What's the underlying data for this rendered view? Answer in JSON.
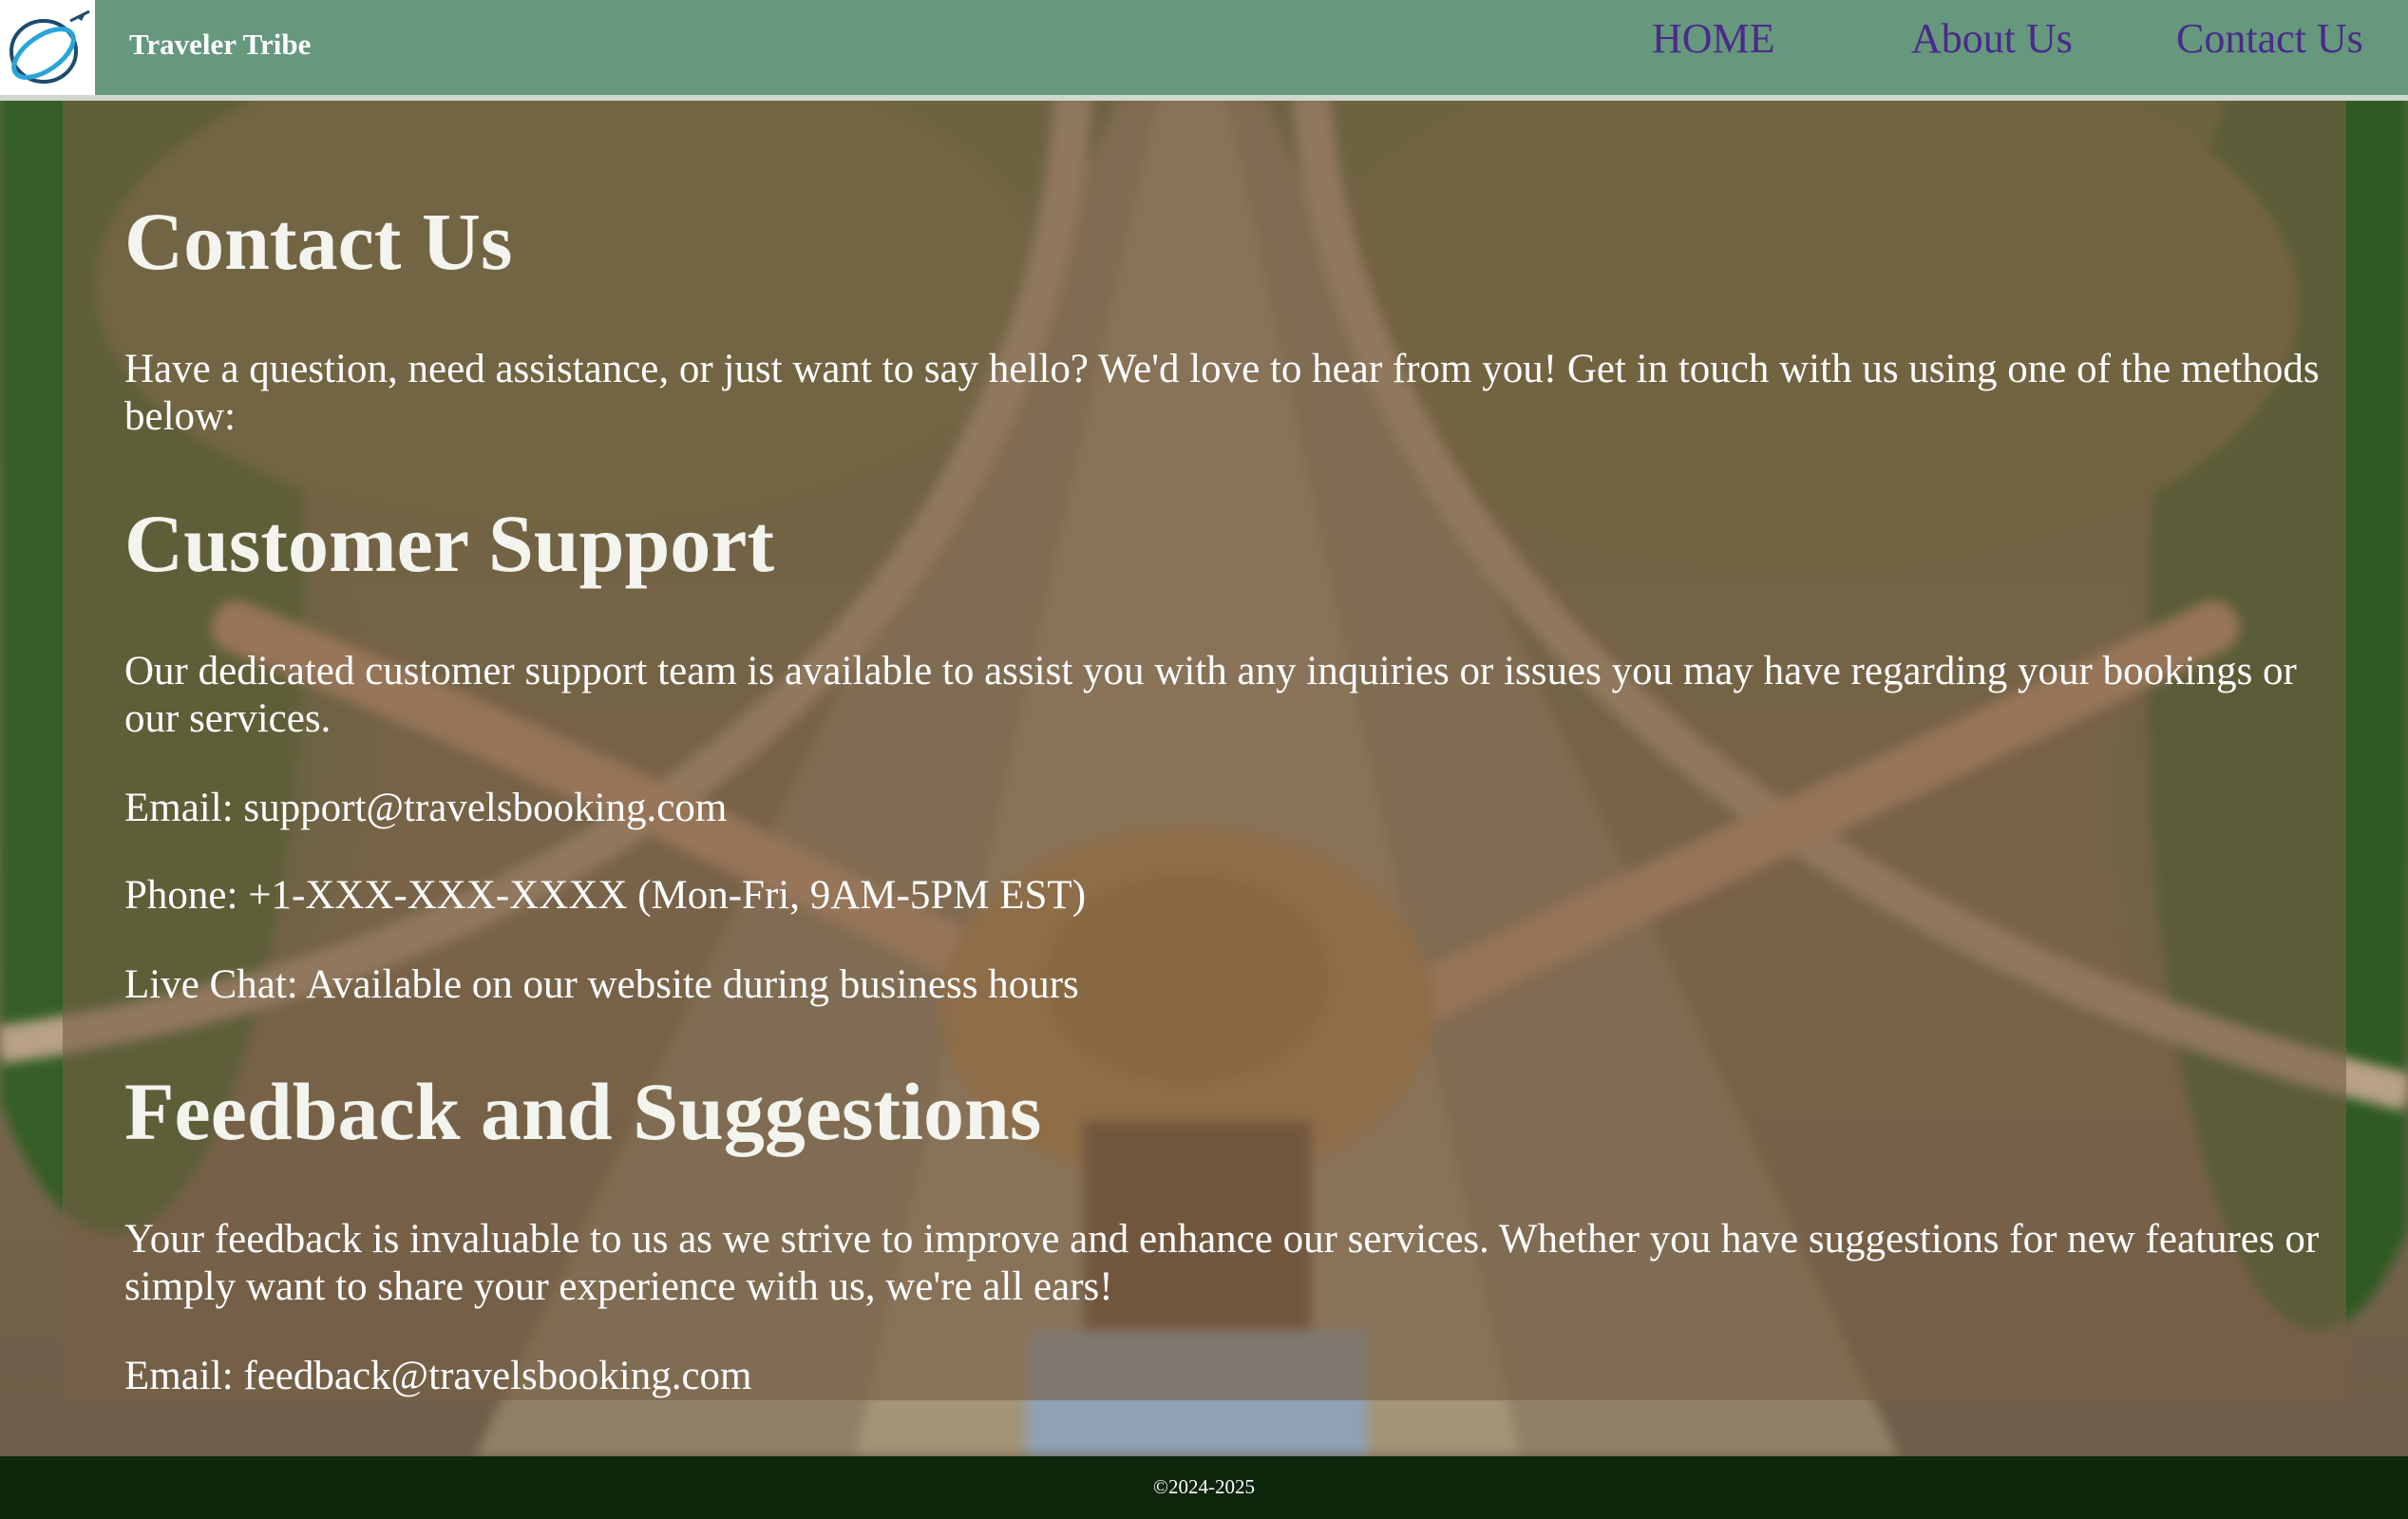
{
  "header": {
    "brand": "Traveler Tribe",
    "logo_icon": "globe-plane-logo",
    "nav": {
      "home": "HOME",
      "about": "About Us",
      "contact": "Contact Us"
    }
  },
  "main": {
    "title": "Contact Us",
    "intro": "Have a question, need assistance, or just want to say hello? We'd love to hear from you! Get in touch with us using one of the methods below:",
    "support": {
      "heading": "Customer Support",
      "description": "Our dedicated customer support team is available to assist you with any inquiries or issues you may have regarding your bookings or our services.",
      "email": "Email: support@travelsbooking.com",
      "phone": "Phone: +1-XXX-XXX-XXXX (Mon-Fri, 9AM-5PM EST)",
      "chat": "Live Chat: Available on our website during business hours"
    },
    "feedback": {
      "heading": "Feedback and Suggestions",
      "description": "Your feedback is invaluable to us as we strive to improve and enhance our services. Whether you have suggestions for new features or simply want to share your experience with us, we're all ears!",
      "email": "Email: feedback@travelsbooking.com"
    }
  },
  "footer": {
    "copyright": "©2024-2025"
  },
  "colors": {
    "header_bg": "#65987c",
    "nav_link": "#4a2a8a",
    "footer_bg": "#0d260c",
    "panel_overlay": "rgba(120, 96, 70, 0.62)"
  }
}
